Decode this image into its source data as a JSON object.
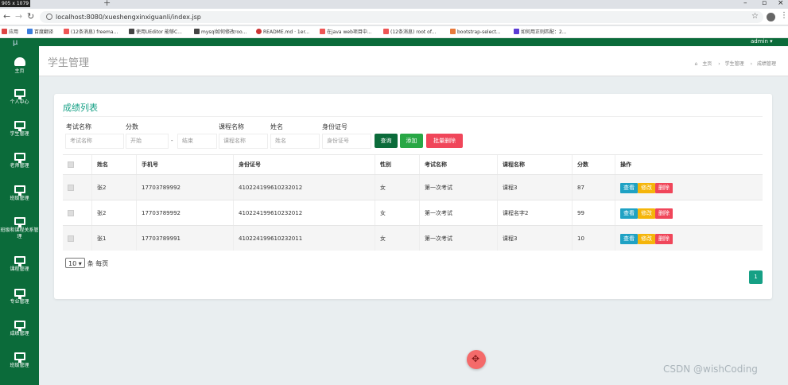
{
  "browser": {
    "tab_title": "905 x 1079",
    "url": "localhost:8080/xueshengxinxiguanli/index.jsp",
    "bookmarks": [
      "应用",
      "百度翻译",
      "(12条消息) freema...",
      "使用UEditor 能够C...",
      "mysql如何修改roo...",
      "README.md · 1er...",
      "在java web项目中...",
      "(12条消息) root of...",
      "bootstrap-select...",
      "如何用正则匹配：2..."
    ]
  },
  "topbar": {
    "user": "admin ▾"
  },
  "sidebar": {
    "logo": "μ",
    "items": [
      {
        "label": "主页"
      },
      {
        "label": "个人中心"
      },
      {
        "label": "学生管理"
      },
      {
        "label": "老师管理"
      },
      {
        "label": "班级管理"
      },
      {
        "label": "班级和课程关系管理"
      },
      {
        "label": "课程管理"
      },
      {
        "label": "专业管理"
      },
      {
        "label": "成绩管理"
      },
      {
        "label": "班级管理"
      }
    ]
  },
  "header": {
    "title": "学生管理",
    "breadcrumb": [
      "主页",
      "学生管理",
      "成绩管理"
    ]
  },
  "card": {
    "title": "成绩列表"
  },
  "filters": {
    "exam_label": "考试名称",
    "exam_placeholder": "考试名称",
    "score_label": "分数",
    "score_start": "开始",
    "score_dash": "-",
    "score_end": "结束",
    "course_label": "课程名称",
    "course_placeholder": "课程名称",
    "name_label": "姓名",
    "name_placeholder": "姓名",
    "id_label": "身份证号",
    "id_placeholder": "身份证号"
  },
  "buttons": {
    "search": "查询",
    "add": "添加",
    "batch_delete": "批量删除",
    "view": "查看",
    "edit": "修改",
    "delete": "删除"
  },
  "table": {
    "headers": [
      "姓名",
      "手机号",
      "身份证号",
      "性别",
      "考试名称",
      "课程名称",
      "分数",
      "操作"
    ],
    "rows": [
      {
        "name": "张2",
        "phone": "17703789992",
        "id": "410224199610232012",
        "gender": "女",
        "exam": "第一次考试",
        "course": "课程3",
        "score": "87"
      },
      {
        "name": "张2",
        "phone": "17703789992",
        "id": "410224199610232012",
        "gender": "女",
        "exam": "第一次考试",
        "course": "课程名字2",
        "score": "99"
      },
      {
        "name": "张1",
        "phone": "17703789991",
        "id": "410224199610232011",
        "gender": "女",
        "exam": "第一次考试",
        "course": "课程3",
        "score": "10"
      }
    ]
  },
  "pagination": {
    "page_size": "10",
    "page_size_suffix": "条 每页",
    "current_page": "1"
  },
  "watermark": "CSDN @wishCoding",
  "colors": {
    "sidebar": "#0b6b3a",
    "accent": "#16a085",
    "search": "#0b6b3a",
    "add": "#28a745",
    "danger": "#f0465a",
    "view": "#1fa2c4",
    "edit": "#f5b50a"
  }
}
